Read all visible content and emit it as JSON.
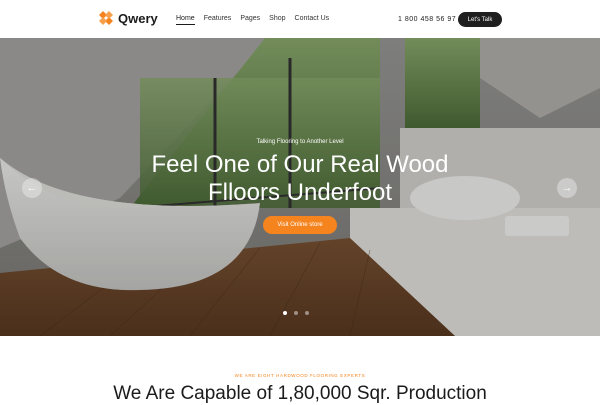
{
  "brand": {
    "name": "Qwery",
    "accent": "#f5841f",
    "logo_icon": "logo-mark-icon"
  },
  "nav": {
    "items": [
      {
        "label": "Home",
        "active": true
      },
      {
        "label": "Features",
        "active": false
      },
      {
        "label": "Pages",
        "active": false
      },
      {
        "label": "Shop",
        "active": false
      },
      {
        "label": "Contact Us",
        "active": false
      }
    ]
  },
  "header": {
    "phone": "1 800 458 56 97",
    "cta_label": "Let's Talk",
    "cta_color": "#1f1f1f"
  },
  "hero": {
    "subtitle": "Talking Flooring to Another Level",
    "title_line1": "Feel One of Our Real Wood",
    "title_line2": "Flloors Underfoot",
    "button_label": "Visit Online store",
    "prev_icon": "arrow-left-icon",
    "next_icon": "arrow-right-icon",
    "slides_total": 3,
    "slide_active": 1
  },
  "section": {
    "kicker": "WE ARE EIGHT HARDWOOD FLOORING EXPERTS",
    "title": "We Are Capable of 1,80,000 Sqr. Production"
  }
}
